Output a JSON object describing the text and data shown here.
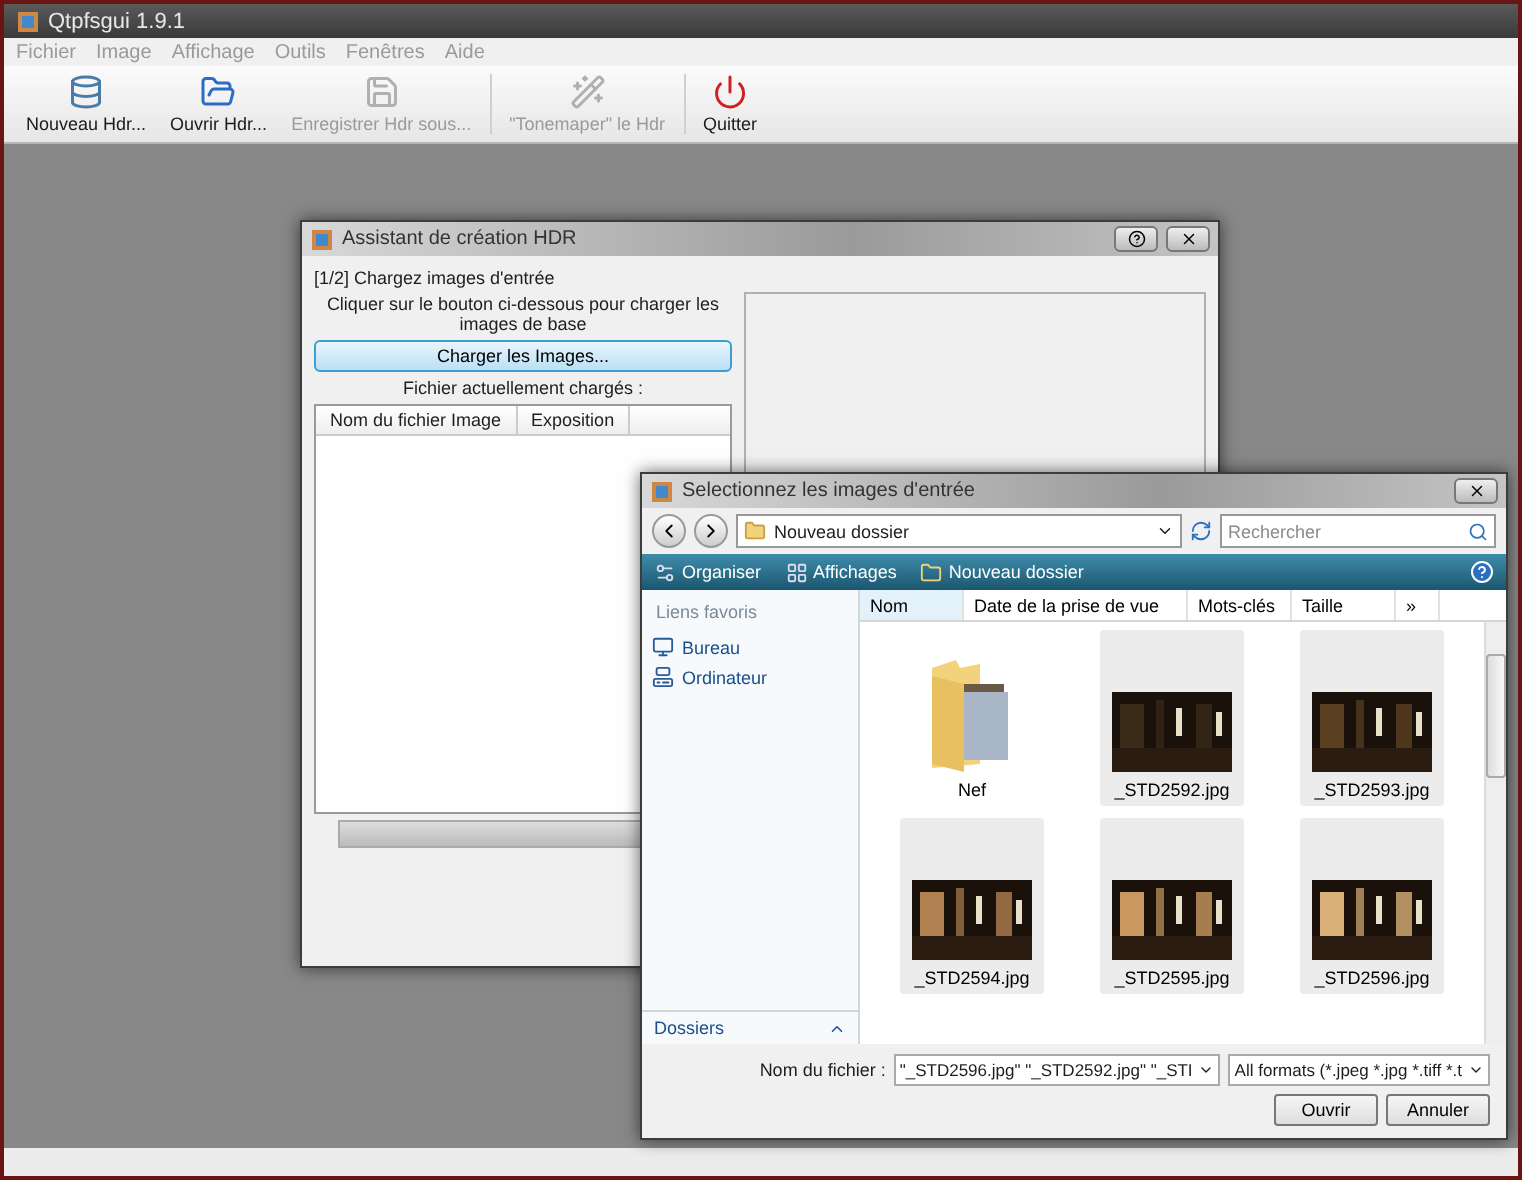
{
  "app": {
    "title": "Qtpfsgui 1.9.1",
    "menu": [
      "Fichier",
      "Image",
      "Affichage",
      "Outils",
      "Fenêtres",
      "Aide"
    ],
    "toolbar": [
      {
        "label": "Nouveau Hdr...",
        "disabled": false
      },
      {
        "label": "Ouvrir Hdr...",
        "disabled": false
      },
      {
        "label": "Enregistrer Hdr sous...",
        "disabled": true
      },
      {
        "label": "\"Tonemaper\" le Hdr",
        "disabled": true
      },
      {
        "label": "Quitter",
        "disabled": false
      }
    ]
  },
  "wizard": {
    "title": "Assistant de création HDR",
    "step": "[1/2] Chargez images d'entrée",
    "instruction": "Cliquer sur le bouton ci-dessous pour charger les images de base",
    "load_button": "Charger les Images...",
    "files_label": "Fichier actuellement chargés :",
    "columns": [
      "Nom du fichier Image",
      "Exposition"
    ],
    "progress": {
      "level": 0
    }
  },
  "dialog": {
    "title": "Selectionnez les images d'entrée",
    "path": "Nouveau dossier",
    "search_placeholder": "Rechercher",
    "toolbar": [
      "Organiser",
      "Affichages",
      "Nouveau dossier"
    ],
    "favorites_title": "Liens favoris",
    "favorites": [
      "Bureau",
      "Ordinateur"
    ],
    "folders_label": "Dossiers",
    "columns": [
      {
        "label": "Nom",
        "selected": true
      },
      {
        "label": "Date de la prise de vue",
        "selected": false
      },
      {
        "label": "Mots-clés",
        "selected": false
      },
      {
        "label": "Taille",
        "selected": false
      },
      {
        "label": "»",
        "selected": false
      }
    ],
    "items": [
      {
        "name": "Nef",
        "kind": "folder",
        "selected": false
      },
      {
        "name": "_STD2592.jpg",
        "kind": "picture",
        "selected": true
      },
      {
        "name": "_STD2593.jpg",
        "kind": "picture",
        "selected": true
      },
      {
        "name": "_STD2594.jpg",
        "kind": "picture",
        "selected": true
      },
      {
        "name": "_STD2595.jpg",
        "kind": "picture",
        "selected": true
      },
      {
        "name": "_STD2596.jpg",
        "kind": "picture",
        "selected": true
      }
    ],
    "filename_label": "Nom du fichier :",
    "filename": "\"_STD2596.jpg\" \"_STD2592.jpg\" \"_STI",
    "filter": "All formats (*.jpeg *.jpg *.tiff *.t",
    "buttons": [
      "Ouvrir",
      "Annuler"
    ]
  }
}
